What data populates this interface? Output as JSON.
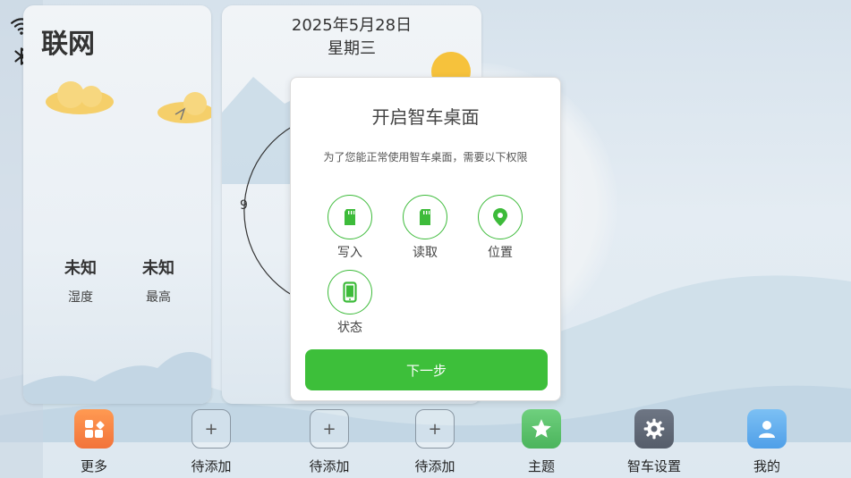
{
  "status": {
    "wifi_icon": "wifi-icon",
    "bluetooth_icon": "bluetooth-icon"
  },
  "weather_card": {
    "title": "联网",
    "stats": [
      {
        "value": "未知",
        "label": "湿度"
      },
      {
        "value": "未知",
        "label": "最高"
      }
    ]
  },
  "clock_card": {
    "date": "2025年5月28日",
    "weekday": "星期三",
    "clock_number": "9"
  },
  "dialog": {
    "title": "开启智车桌面",
    "description": "为了您能正常使用智车桌面，需要以下权限",
    "permissions": [
      {
        "label": "写入",
        "icon": "sd-card-icon"
      },
      {
        "label": "读取",
        "icon": "sd-card-icon"
      },
      {
        "label": "位置",
        "icon": "location-pin-icon"
      },
      {
        "label": "状态",
        "icon": "phone-icon"
      }
    ],
    "next_button": "下一步",
    "accent_color": "#3dbf3a"
  },
  "dock": [
    {
      "label": "更多",
      "icon": "apps-grid-icon",
      "color": "#f47a3c"
    },
    {
      "label": "待添加",
      "icon": "plus-icon",
      "glyph": "+"
    },
    {
      "label": "待添加",
      "icon": "plus-icon",
      "glyph": "+"
    },
    {
      "label": "待添加",
      "icon": "plus-icon",
      "glyph": "+"
    },
    {
      "label": "主题",
      "icon": "star-icon",
      "color": "#58c26a"
    },
    {
      "label": "智车设置",
      "icon": "gear-icon",
      "color": "#5c6472"
    },
    {
      "label": "我的",
      "icon": "user-icon",
      "color": "#5aa9ec"
    }
  ]
}
